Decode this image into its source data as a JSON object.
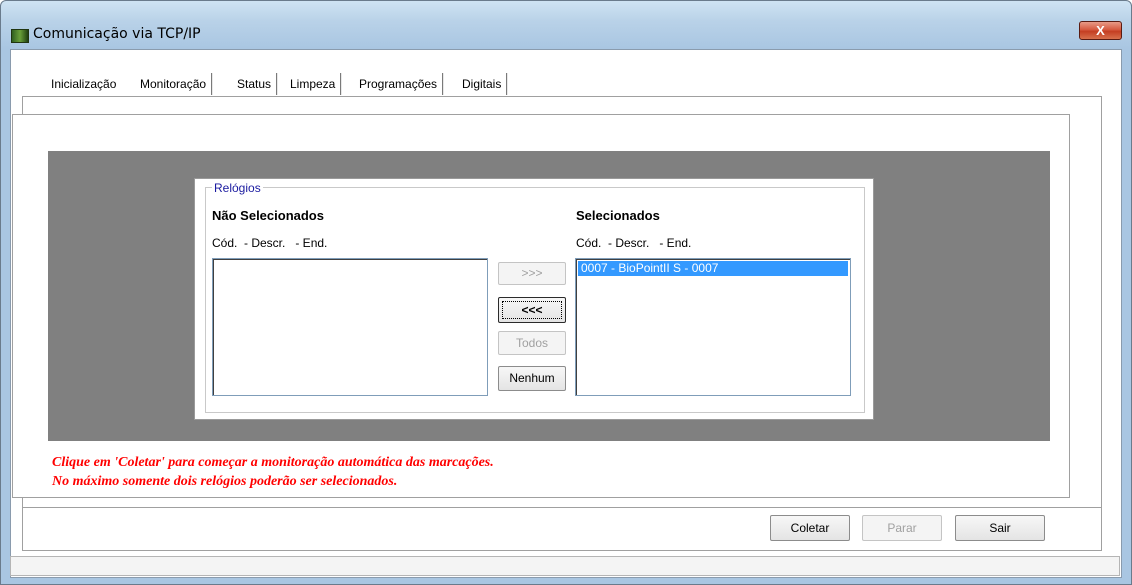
{
  "window": {
    "title": "Comunicação via TCP/IP",
    "close_glyph": "X"
  },
  "tabs": [
    {
      "label": "Inicialização"
    },
    {
      "label": "Monitoração"
    },
    {
      "label": "Status"
    },
    {
      "label": "Limpeza"
    },
    {
      "label": "Programações"
    },
    {
      "label": "Digitais"
    }
  ],
  "active_tab": "Monitoração",
  "relogios": {
    "group_label": "Relógios",
    "unselected": {
      "title": "Não Selecionados",
      "columns": "Cód.  - Descr.   - End.",
      "items": []
    },
    "selected": {
      "title": "Selecionados",
      "columns": "Cód.  - Descr.   - End.",
      "items": [
        "0007 - BioPointII S - 0007"
      ]
    },
    "buttons": {
      "add": ">>>",
      "remove": "<<<",
      "all": "Todos",
      "none": "Nenhum"
    }
  },
  "hints": [
    "Clique em 'Coletar' para começar a monitoração automática das marcações.",
    "No máximo somente dois relógios poderão ser selecionados."
  ],
  "actions": {
    "collect": "Coletar",
    "stop": "Parar",
    "exit": "Sair"
  },
  "colors": {
    "hint_text": "#ff0000",
    "selection": "#3399ff",
    "group_legend": "#1a1aa0",
    "dark_area": "#808080"
  }
}
